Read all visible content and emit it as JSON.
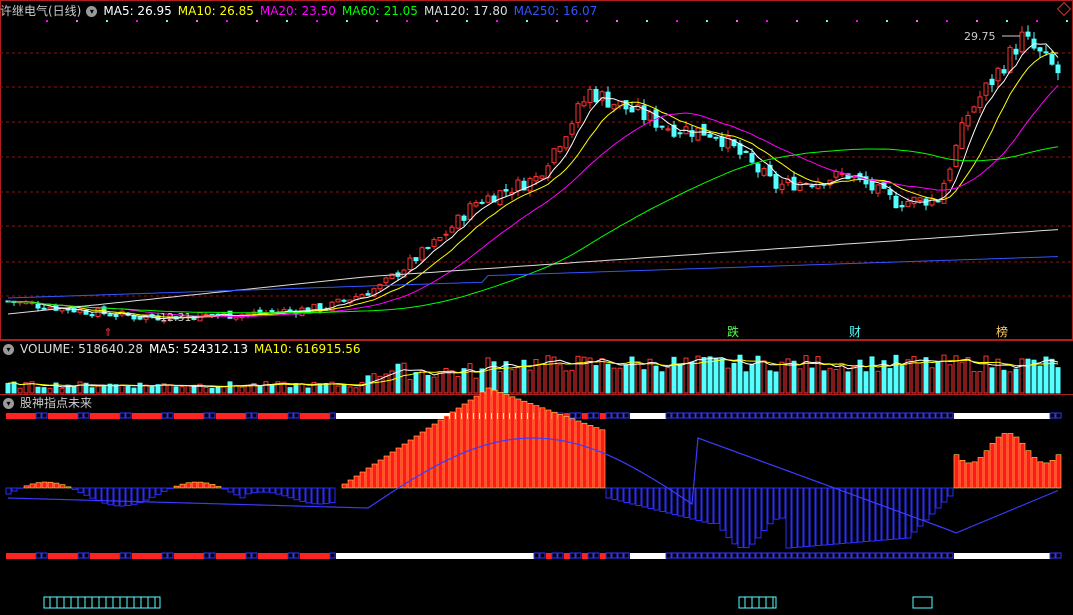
{
  "main": {
    "title": "许继电气(日线)",
    "ma_labels": [
      {
        "text": "MA5: 26.95",
        "color": "#ffffff"
      },
      {
        "text": "MA10: 26.85",
        "color": "#ffff00"
      },
      {
        "text": "MA20: 23.50",
        "color": "#ff00ff"
      },
      {
        "text": "MA60: 21.05",
        "color": "#00ff00"
      },
      {
        "text": "MA120: 17.80",
        "color": "#dddddd"
      },
      {
        "text": "MA250: 16.07",
        "color": "#3355ff"
      }
    ],
    "high_label": "29.75",
    "low_label": "12.31",
    "event_marks": [
      "跌",
      "财",
      "榜"
    ]
  },
  "volume": {
    "labels": [
      {
        "text": "VOLUME: 518640.28",
        "color": "#dddddd"
      },
      {
        "text": "MA5: 524312.13",
        "color": "#ffffff"
      },
      {
        "text": "MA10: 616915.56",
        "color": "#ffff00"
      }
    ]
  },
  "indicator": {
    "title": "股神指点未来"
  },
  "colors": {
    "up": "#ff3333",
    "down": "#54ffff",
    "grid": "#8a1414",
    "frame": "#b01e1e",
    "ma5": "#ffffff",
    "ma10": "#ffff00",
    "ma20": "#ff00ff",
    "ma60": "#00ff00",
    "ma120": "#dddddd",
    "ma250": "#3355ff"
  },
  "chart_data": {
    "type": "candlestick",
    "price_range": [
      11.5,
      31.0
    ],
    "key_prices": {
      "high": 29.75,
      "low": 12.31
    },
    "moving_averages_latest": {
      "MA5": 26.95,
      "MA10": 26.85,
      "MA20": 23.5,
      "MA60": 21.05,
      "MA120": 17.8,
      "MA250": 16.07
    },
    "volume_latest": {
      "VOLUME": 518640.28,
      "MA5": 524312.13,
      "MA10": 616915.56
    }
  }
}
